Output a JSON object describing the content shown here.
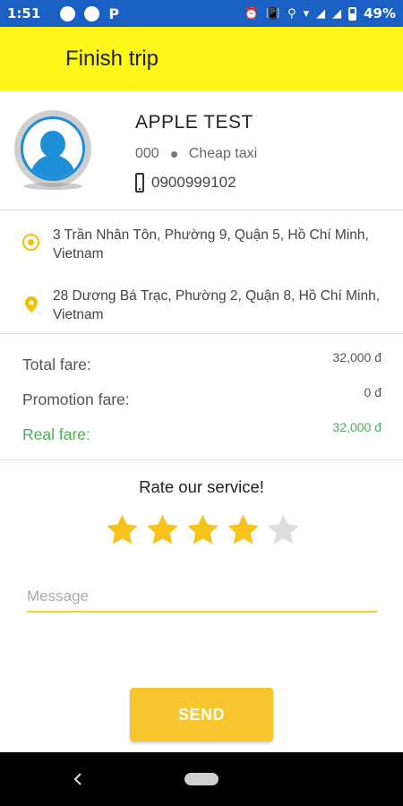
{
  "status_bar": {
    "time": "1:51",
    "p_label": "P",
    "battery_percent": "49%"
  },
  "header": {
    "title": "Finish trip"
  },
  "driver": {
    "name": "APPLE TEST",
    "plate": "000",
    "vehicle_type": "Cheap taxi",
    "phone": "0900999102"
  },
  "route": {
    "origin": "3 Trần Nhân Tôn, Phường 9, Quận 5, Hồ Chí Minh, Vietnam",
    "destination": "28 Dương Bá Trạc, Phường 2, Quận 8, Hồ Chí Minh, Vietnam"
  },
  "fares": {
    "total_label": "Total fare:",
    "total_value": "32,000 đ",
    "promotion_label": "Promotion fare:",
    "promotion_value": "0 đ",
    "real_label": "Real fare:",
    "real_value": "32,000 đ"
  },
  "rating": {
    "title": "Rate our service!",
    "stars_filled": 4,
    "stars_total": 5
  },
  "message": {
    "placeholder": "Message",
    "value": ""
  },
  "send_button": {
    "label": "SEND"
  },
  "colors": {
    "status_bar": "#1a5fc4",
    "header": "#fff61a",
    "accent": "#f7c52e",
    "real_fare": "#4caf50",
    "star_filled": "#f7c21a",
    "star_empty": "#dddddd"
  }
}
